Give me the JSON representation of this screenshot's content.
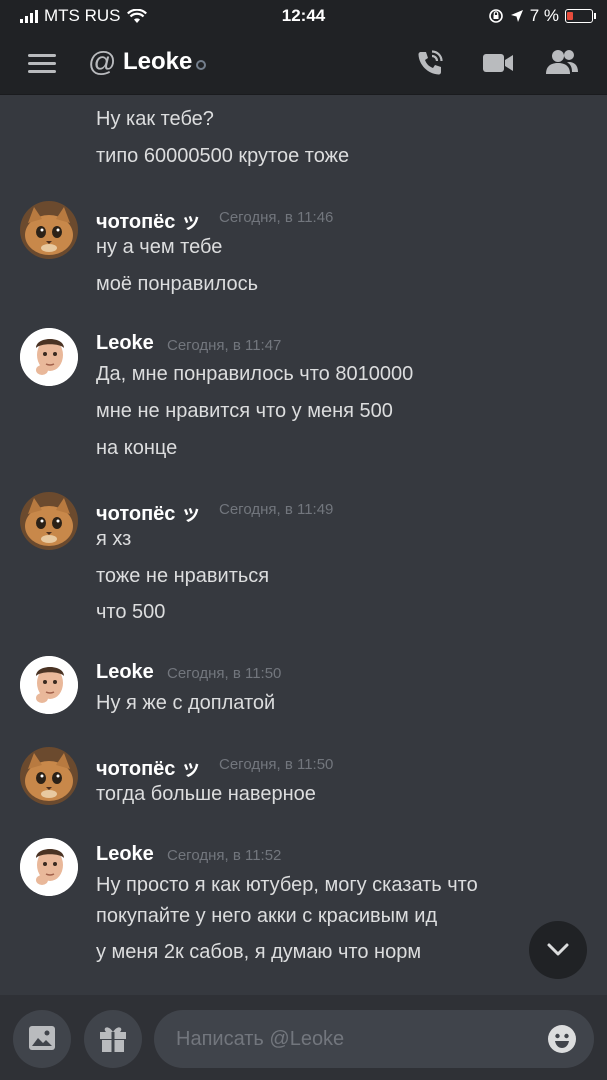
{
  "status_bar": {
    "carrier": "MTS RUS",
    "time": "12:44",
    "battery_percent": "7 %"
  },
  "header": {
    "at_symbol": "@",
    "title": "Leoke"
  },
  "messages": [
    {
      "type": "continuation",
      "text": "Ну как тебе?"
    },
    {
      "type": "continuation",
      "text": "типо 60000500 крутое тоже"
    },
    {
      "type": "group",
      "author": "чотопёс ッ",
      "avatar": "cat-avatar",
      "timestamp": "Сегодня, в 11:46",
      "lines": [
        "ну а чем тебе",
        "моё понравилось"
      ]
    },
    {
      "type": "group",
      "author": "Leoke",
      "avatar": "memoji-avatar",
      "timestamp": "Сегодня, в 11:47",
      "lines": [
        "Да, мне понравилось что 8010000",
        "мне не нравится что у меня 500",
        "на конце"
      ]
    },
    {
      "type": "group",
      "author": "чотопёс ッ",
      "avatar": "cat-avatar",
      "timestamp": "Сегодня, в 11:49",
      "lines": [
        "я хз",
        "тоже не нравиться",
        "что 500"
      ]
    },
    {
      "type": "group",
      "author": "Leoke",
      "avatar": "memoji-avatar",
      "timestamp": "Сегодня, в 11:50",
      "lines": [
        "Ну я же с доплатой"
      ]
    },
    {
      "type": "group",
      "author": "чотопёс ッ",
      "avatar": "cat-avatar",
      "timestamp": "Сегодня, в 11:50",
      "lines": [
        "тогда больше наверное"
      ]
    },
    {
      "type": "group",
      "author": "Leoke",
      "avatar": "memoji-avatar",
      "timestamp": "Сегодня, в 11:52",
      "lines": [
        "Ну просто я как ютубер, могу сказать что",
        "покупайте у него акки с красивым ид",
        "у меня 2к сабов, я думаю что норм"
      ]
    }
  ],
  "composer": {
    "placeholder": "Написать @Leoke"
  },
  "colors": {
    "background": "#36393f",
    "header": "#202225",
    "text": "#dcddde",
    "timestamp": "#72767d"
  }
}
